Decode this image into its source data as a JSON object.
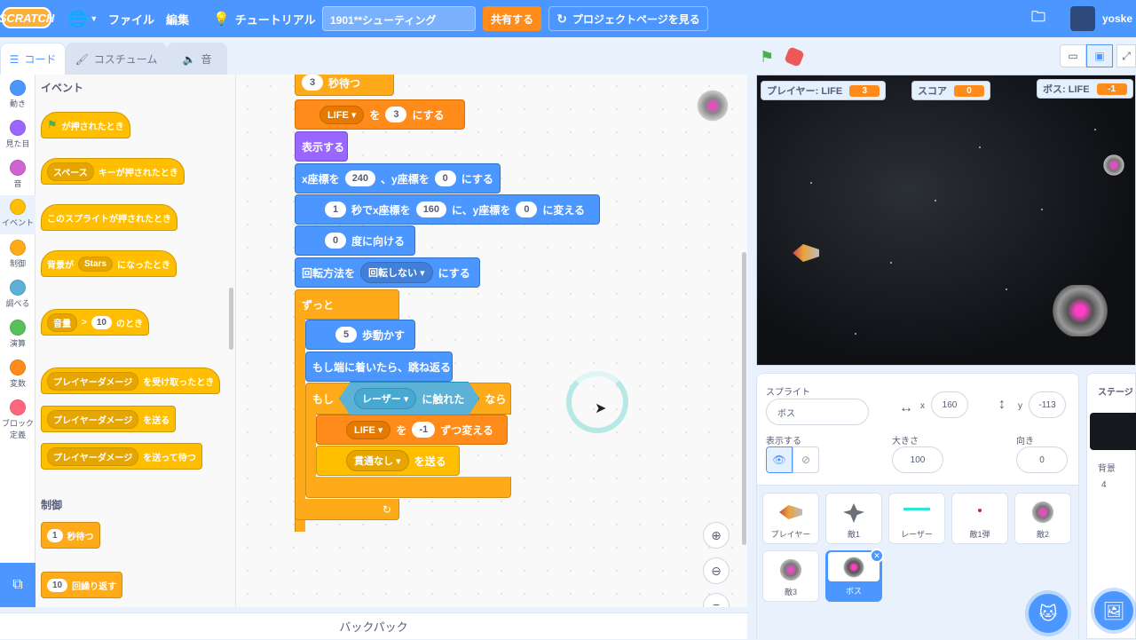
{
  "menubar": {
    "logo": "SCRATCH",
    "file": "ファイル",
    "edit": "編集",
    "tutorial": "チュートリアル",
    "title": "1901**シューティング",
    "share": "共有する",
    "project_page": "プロジェクトページを見る",
    "user": "yoske"
  },
  "tabs": {
    "code": "コード",
    "costume": "コスチューム",
    "sound": "音"
  },
  "categories": [
    {
      "label": "動き",
      "color": "#4c97ff"
    },
    {
      "label": "見た目",
      "color": "#9966ff"
    },
    {
      "label": "音",
      "color": "#cf63cf"
    },
    {
      "label": "イベント",
      "color": "#ffbf00"
    },
    {
      "label": "制御",
      "color": "#ffab19"
    },
    {
      "label": "調べる",
      "color": "#5cb1d6"
    },
    {
      "label": "演算",
      "color": "#59c059"
    },
    {
      "label": "変数",
      "color": "#ff8c1a"
    },
    {
      "label": "ブロック定義",
      "color": "#ff6680"
    }
  ],
  "palette": {
    "events_head": "イベント",
    "flag_clicked": "が押されたとき",
    "key_drop": "スペース",
    "key_text": "キーが押されたとき",
    "sprite_clicked": "このスプライトが押されたとき",
    "backdrop_pre": "背景が",
    "backdrop_drop": "Stars",
    "backdrop_post": "になったとき",
    "loud_drop": "音量",
    "loud_op": ">",
    "loud_val": "10",
    "loud_post": "のとき",
    "recv_drop": "プレイヤーダメージ",
    "recv_post": "を受け取ったとき",
    "bcast_drop": "プレイヤーダメージ",
    "bcast_post": "を送る",
    "bcastw_drop": "プレイヤーダメージ",
    "bcastw_post": "を送って待つ",
    "control_head": "制御",
    "wait_val": "1",
    "wait_post": "秒待つ",
    "repeat_val": "10",
    "repeat_post": "回繰り返す"
  },
  "script": {
    "wait_val": "3",
    "wait_post": "秒待つ",
    "setvar_drop": "LIFE",
    "setvar_mid": "を",
    "setvar_val": "3",
    "setvar_post": "にする",
    "show": "表示する",
    "goto_pre": "x座標を",
    "goto_x": "240",
    "goto_mid": "、y座標を",
    "goto_y": "0",
    "goto_post": "にする",
    "glide_secs": "1",
    "glide_mid": "秒でx座標を",
    "glide_x": "160",
    "glide_mid2": "に、y座標を",
    "glide_y": "0",
    "glide_post": "に変える",
    "dir_val": "0",
    "dir_post": "度に向ける",
    "rot_pre": "回転方法を",
    "rot_drop": "回転しない",
    "rot_post": "にする",
    "forever": "ずっと",
    "move_val": "5",
    "move_post": "歩動かす",
    "bounce": "もし端に着いたら、跳ね返る",
    "if": "もし",
    "touch_drop": "レーザー",
    "touch_post": "に触れた",
    "then": "なら",
    "change_drop": "LIFE",
    "change_mid": "を",
    "change_val": "-1",
    "change_post": "ずつ変える",
    "send_drop": "貫通なし",
    "send_post": "を送る"
  },
  "backpack": "バックパック",
  "stage": {
    "monitors": [
      {
        "label": "プレイヤー: LIFE",
        "value": "3"
      },
      {
        "label": "スコア",
        "value": "0"
      },
      {
        "label": "ボス: LIFE",
        "value": "-1"
      }
    ]
  },
  "sprite_info": {
    "sprite_label": "スプライト",
    "name": "ボス",
    "x_label": "x",
    "x": "160",
    "y_label": "y",
    "y": "-113",
    "show_label": "表示する",
    "size_label": "大きさ",
    "size": "100",
    "dir_label": "向き",
    "dir": "0"
  },
  "sprites": [
    "プレイヤー",
    "敵1",
    "レーザー",
    "敵1弾",
    "敵2",
    "敵3",
    "ボス"
  ],
  "stage_pane": {
    "label": "ステージ",
    "bg_label": "背景",
    "bg_count": "4"
  }
}
